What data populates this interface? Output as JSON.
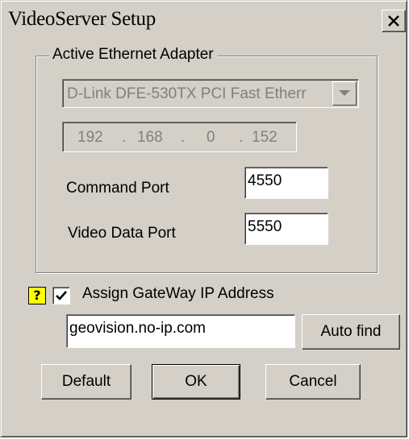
{
  "window": {
    "title": "VideoServer Setup"
  },
  "adapter_group": {
    "legend": "Active Ethernet Adapter",
    "adapter_selected": "D-Link DFE-530TX PCI Fast Etherr",
    "ip_address": [
      "192",
      "168",
      "0",
      "152"
    ],
    "command_port_label": "Command Port",
    "command_port_value": "4550",
    "video_port_label": "Video Data Port",
    "video_port_value": "5550"
  },
  "gateway": {
    "help_icon": "?",
    "checkbox_checked": true,
    "checkbox_label": "Assign GateWay IP Address",
    "address_value": "geovision.no-ip.com",
    "auto_find_label": "Auto find"
  },
  "buttons": {
    "default_label": "Default",
    "ok_label": "OK",
    "cancel_label": "Cancel"
  },
  "colors": {
    "dialog_face": "#d4d0c8",
    "help_icon_bg": "#ffff00",
    "disabled_text": "#808080"
  }
}
